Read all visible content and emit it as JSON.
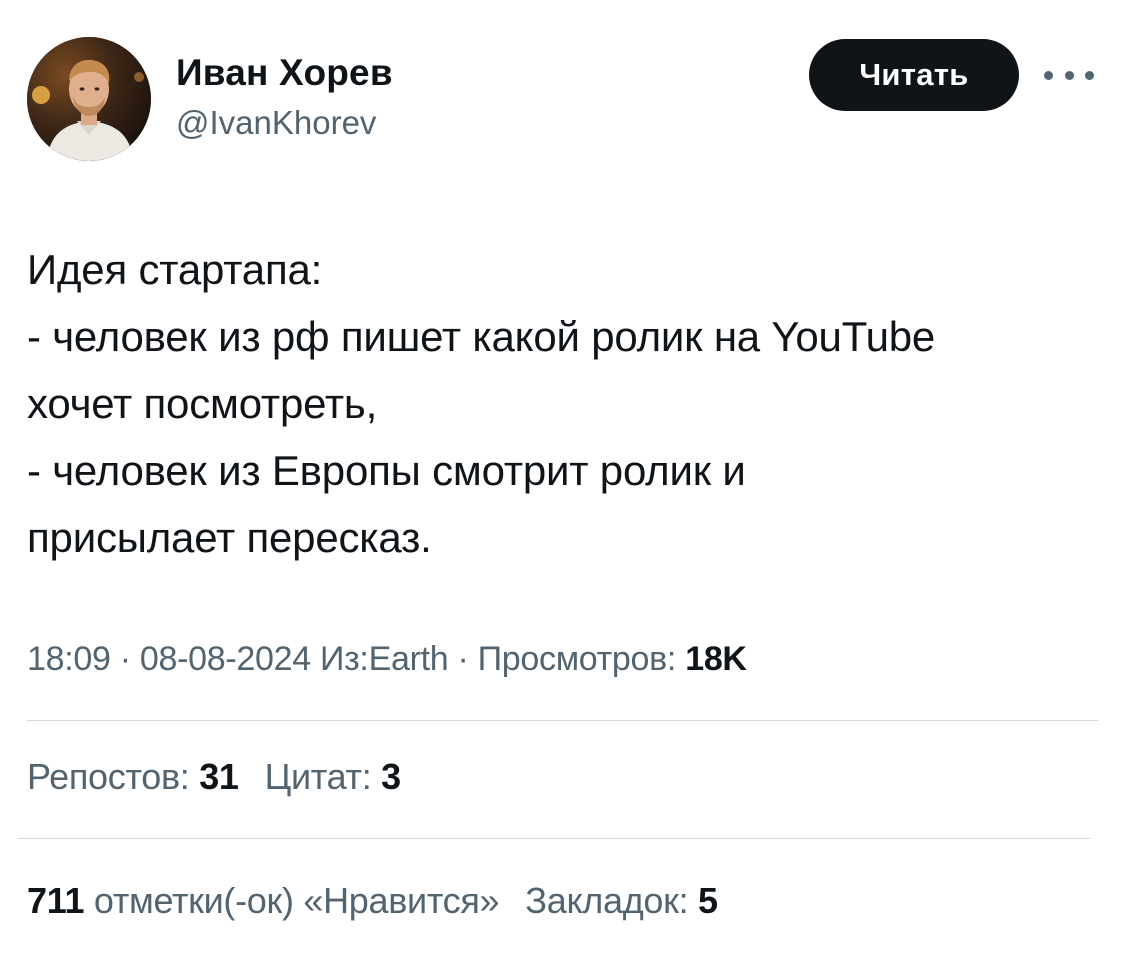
{
  "author": {
    "name": "Иван Хорев",
    "handle": "@IvanKhorev",
    "avatar_icon": "user-avatar-photo"
  },
  "header": {
    "follow_label": "Читать",
    "more_icon": "more-horizontal-icon"
  },
  "tweet": {
    "lines": [
      "Идея стартапа:",
      "- человек из рф пишет какой ролик на YouTube",
      "хочет посмотреть,",
      "- человек из Европы смотрит ролик и",
      "присылает пересказ."
    ]
  },
  "meta": {
    "time": "18:09",
    "separator1": " · ",
    "date": "08-08-2024",
    "source_prefix": " Из:",
    "source": "Earth",
    "separator2": " · ",
    "views_label": "Просмотров: ",
    "views_value": "18K"
  },
  "stats": {
    "reposts_label": "Репостов: ",
    "reposts_value": "31",
    "quotes_label": "Цитат: ",
    "quotes_value": "3",
    "likes_value": "711",
    "likes_label": " отметки(-ок) «Нравится»",
    "bookmarks_label": "Закладок: ",
    "bookmarks_value": "5"
  },
  "colors": {
    "text_primary": "#0f1419",
    "text_secondary": "#536471",
    "divider": "#cfd9de",
    "button_bg": "#0f1419"
  }
}
